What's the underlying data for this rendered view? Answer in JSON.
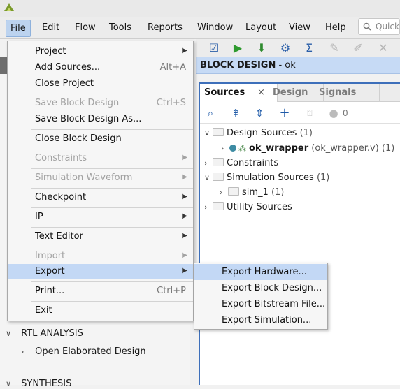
{
  "menubar": {
    "file": "File",
    "edit": "Edit",
    "flow": "Flow",
    "tools": "Tools",
    "reports": "Reports",
    "window": "Window",
    "layout": "Layout",
    "view": "View",
    "help": "Help",
    "quick_placeholder": "Quick"
  },
  "header": {
    "prefix": "BLOCK DESIGN",
    "suffix": " - ok"
  },
  "tabs": {
    "sources": "Sources",
    "design": "Design",
    "signals": "Signals"
  },
  "sources_toolbar": {
    "count": "0"
  },
  "tree": {
    "design_sources": {
      "label": "Design Sources",
      "count": "(1)"
    },
    "ok_wrapper": {
      "label": "ok_wrapper",
      "detail": "(ok_wrapper.v) (1)"
    },
    "constraints": {
      "label": "Constraints"
    },
    "simulation_sources": {
      "label": "Simulation Sources",
      "count": "(1)"
    },
    "sim_1": {
      "label": "sim_1",
      "count": "(1)"
    },
    "utility_sources": {
      "label": "Utility Sources"
    }
  },
  "left_tree": {
    "rtl_analysis": "RTL ANALYSIS",
    "open_elaborated": "Open Elaborated Design",
    "synthesis": "SYNTHESIS"
  },
  "file_menu": {
    "project": "Project",
    "add_sources": "Add Sources...",
    "add_sources_sc": "Alt+A",
    "close_project": "Close Project",
    "save_bd": "Save Block Design",
    "save_bd_sc": "Ctrl+S",
    "save_bd_as": "Save Block Design As...",
    "close_bd": "Close Block Design",
    "constraints": "Constraints",
    "sim_waveform": "Simulation Waveform",
    "checkpoint": "Checkpoint",
    "ip": "IP",
    "text_editor": "Text Editor",
    "import": "Import",
    "export": "Export",
    "print": "Print...",
    "print_sc": "Ctrl+P",
    "exit": "Exit"
  },
  "export_submenu": {
    "hardware": "Export Hardware...",
    "block_design": "Export Block Design...",
    "bitstream": "Export Bitstream File...",
    "simulation": "Export Simulation..."
  }
}
